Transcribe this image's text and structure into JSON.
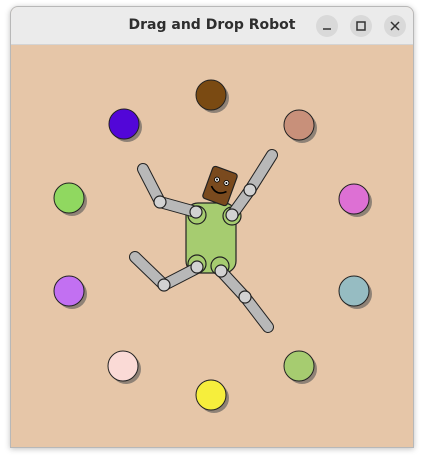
{
  "window": {
    "title": "Drag and Drop Robot",
    "buttons": [
      "minimize",
      "maximize",
      "close"
    ]
  },
  "canvas": {
    "background": "#e6c6a8",
    "color_swatches": [
      {
        "name": "brown",
        "color": "#7a4a12"
      },
      {
        "name": "tan",
        "color": "#c8907a"
      },
      {
        "name": "pink",
        "color": "#dd70d4"
      },
      {
        "name": "slate",
        "color": "#96bcc2"
      },
      {
        "name": "olive-green",
        "color": "#a6cc70"
      },
      {
        "name": "yellow",
        "color": "#f6ee3c"
      },
      {
        "name": "light-pink",
        "color": "#fadad6"
      },
      {
        "name": "lavender",
        "color": "#c270f2"
      },
      {
        "name": "green",
        "color": "#90d860"
      },
      {
        "name": "indigo",
        "color": "#5206d8"
      }
    ]
  },
  "robot": {
    "body_color": "#a6cc70",
    "head_color": "#7a4a1e",
    "limb_color": "#b8b8b8",
    "joint_color": "#d2d2d2"
  }
}
